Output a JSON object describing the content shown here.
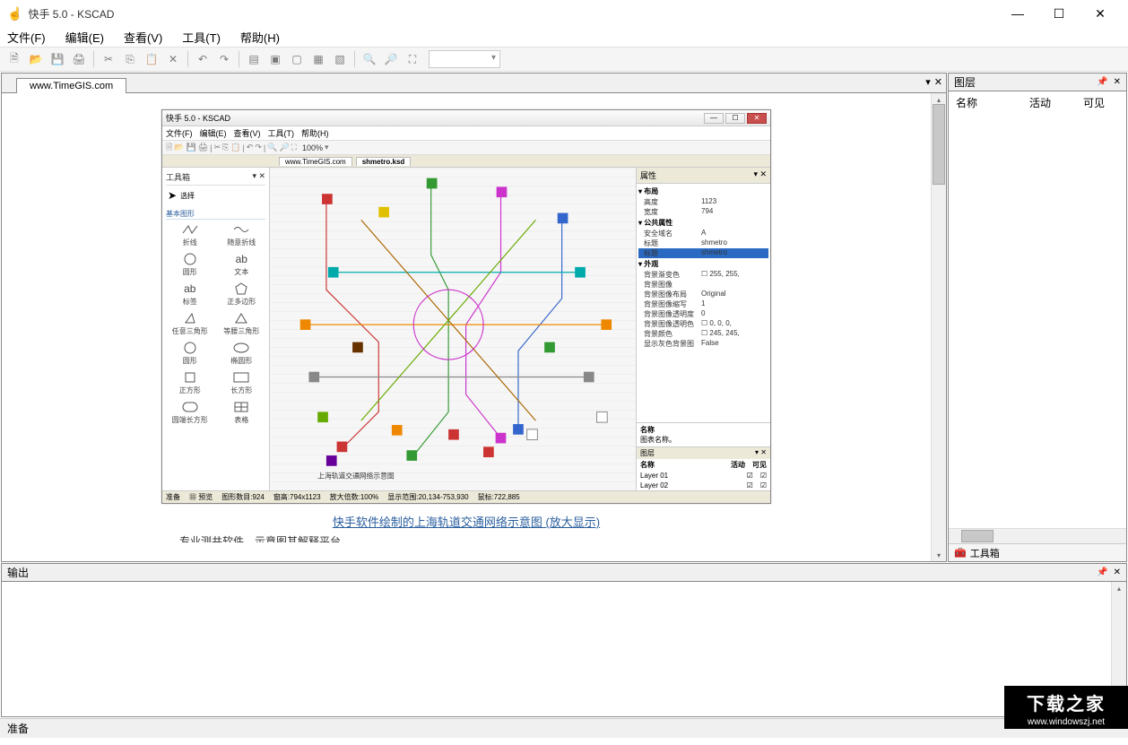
{
  "title": "快手 5.0 - KSCAD",
  "menu": {
    "file": "文件(F)",
    "edit": "编辑(E)",
    "view": "查看(V)",
    "tool": "工具(T)",
    "help": "帮助(H)"
  },
  "doc_tab": "www.TimeGIS.com",
  "right_panel": {
    "title": "图层",
    "col_name": "名称",
    "col_active": "活动",
    "col_visible": "可见",
    "footer_tab": "工具箱"
  },
  "output_panel": {
    "title": "输出"
  },
  "status": "准备",
  "caption_link": "快手软件绘制的上海轨道交通网络示意图 (放大显示)",
  "truncated_row": "专业测井软件，示意图其解释平台",
  "inner": {
    "title": "快手 5.0 - KSCAD",
    "menu": {
      "file": "文件(F)",
      "edit": "编辑(E)",
      "view": "查看(V)",
      "tool": "工具(T)",
      "help": "帮助(H)"
    },
    "zoom": "100%",
    "tabs": {
      "t1": "www.TimeGIS.com",
      "t2": "shmetro.ksd"
    },
    "toolbox": {
      "title": "工具箱",
      "select": "选择",
      "section_basic": "基本图形",
      "tools": {
        "line": "折线",
        "polyline": "随意折线",
        "circle": "圆形",
        "text": "文本",
        "text2": "标签",
        "polygon": "正多边形",
        "triangle": "任意三角形",
        "rtriangle": "等腰三角形",
        "ellipse1": "圆形",
        "ellipse2": "椭圆形",
        "square": "正方形",
        "rect": "长方形",
        "roundrect": "圆端长方形",
        "table": "表格"
      },
      "text_sample": "ab"
    },
    "canvas_caption": "上海轨道交通网络示意图",
    "status_ready": "准备",
    "status_label": "预览",
    "status_count": "图形数目:924",
    "status_size": "窗高:794x1123",
    "status_zoom": "放大倍数:100%",
    "status_range": "显示范围:20,134-753,930",
    "status_mouse": "鼠标:722,885",
    "props": {
      "title": "属性",
      "cat_layout": "布局",
      "h": "高度",
      "h_v": "1123",
      "w": "宽度",
      "w_v": "794",
      "cat_public": "公共属性",
      "fullname": "安全域名",
      "fullname_v": "A",
      "name": "标题",
      "name_v": "shmetro",
      "key": "标题",
      "key_v": "shmetro",
      "cat_appearance": "外观",
      "bgcolor": "背景渐变色",
      "bgcolor_v": "255, 255,",
      "bgimage": "背景图像",
      "bglayout": "背景图像布局",
      "bglayout_v": "Original",
      "bgscale": "背景图像缩写",
      "bgscale_v": "1",
      "bgopacity": "背景图像透明度",
      "bgopacity_v": "0",
      "bgtint": "背景图像透明色",
      "bgtint_v": "0, 0, 0,",
      "bgfill": "背景颜色",
      "bgfill_v": "245, 245,",
      "showgray": "显示灰色背景图",
      "showgray_v": "False",
      "desc_name": "名称",
      "desc_text": "图表名称。",
      "layer_title": "图层",
      "layer_col1": "名称",
      "layer_col2": "活动",
      "layer_col3": "可见",
      "layer1": "Layer 01",
      "layer2": "Layer 02"
    }
  },
  "watermark": {
    "big": "下载之家",
    "url": "www.windowszj.net"
  }
}
